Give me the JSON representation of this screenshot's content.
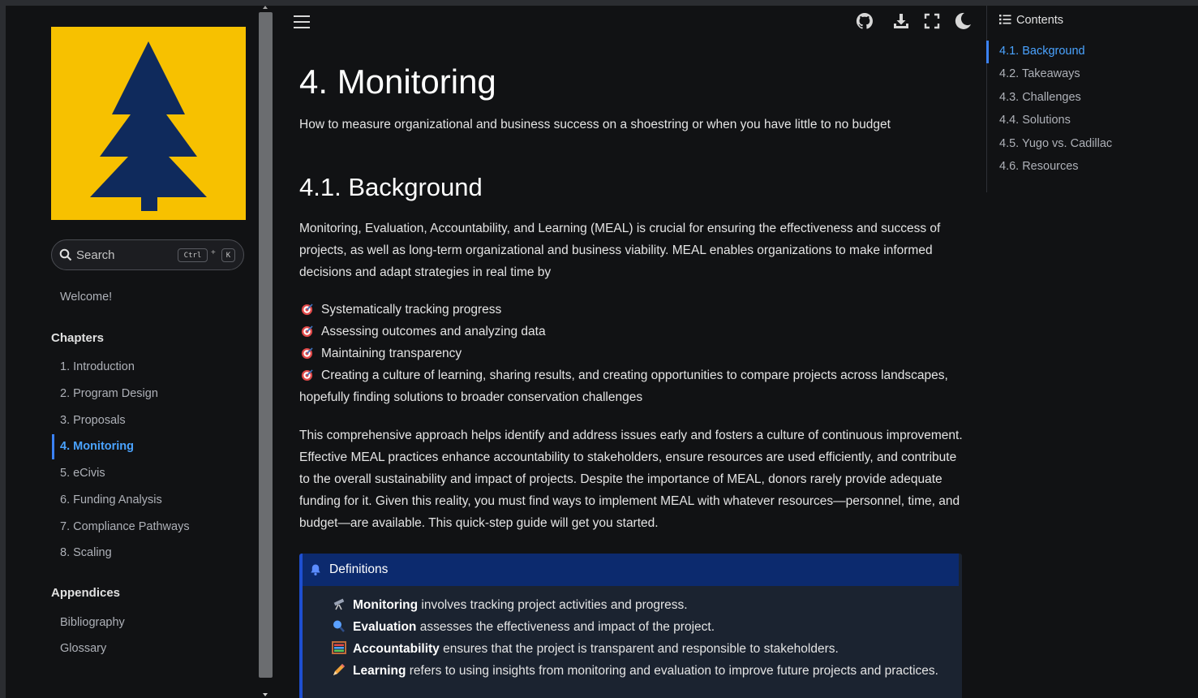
{
  "sidebar": {
    "search": {
      "label": "Search",
      "kbd_ctrl": "Ctrl",
      "kbd_plus": "+",
      "kbd_k": "K"
    },
    "welcome": "Welcome!",
    "chapters_heading": "Chapters",
    "chapters": [
      "1. Introduction",
      "2. Program Design",
      "3. Proposals",
      "4. Monitoring",
      "5. eCivis",
      "6. Funding Analysis",
      "7. Compliance Pathways",
      "8. Scaling"
    ],
    "appendices_heading": "Appendices",
    "appendices": [
      "Bibliography",
      "Glossary"
    ]
  },
  "toolbar": {
    "icons": [
      "menu-icon",
      "github-icon",
      "download-icon",
      "fullscreen-icon",
      "moon-icon"
    ]
  },
  "main": {
    "title": "4. Monitoring",
    "subtitle": "How to measure organizational and business success on a shoestring or when you have little to no budget",
    "section_title": "4.1. Background",
    "intro": "Monitoring, Evaluation, Accountability, and Learning (MEAL) is crucial for ensuring the effectiveness and success of projects, as well as long-term organizational and business viability. MEAL enables organizations to make informed decisions and adapt strategies in real time by",
    "bullets": [
      "Systematically tracking progress",
      "Assessing outcomes and analyzing data",
      "Maintaining transparency",
      "Creating a culture of learning, sharing results, and creating opportunities to compare projects across landscapes, hopefully finding solutions to broader conservation challenges"
    ],
    "paragraph2": "This comprehensive approach helps identify and address issues early and fosters a culture of continuous improvement. Effective MEAL practices enhance accountability to stakeholders, ensure resources are used efficiently, and contribute to the overall sustainability and impact of projects. Despite the importance of MEAL, donors rarely provide adequate funding for it. Given this reality, you must find ways to implement MEAL with whatever resources—personnel, time, and budget—are available. This quick-step guide will get you started.",
    "definitions": {
      "title": "Definitions",
      "items": [
        {
          "term": "Monitoring",
          "text": "involves tracking project activities and progress.",
          "icon": "telescope-icon"
        },
        {
          "term": "Evaluation",
          "text": "assesses the effectiveness and impact of the project.",
          "icon": "magnifier-icon"
        },
        {
          "term": "Accountability",
          "text": "ensures that the project is transparent and responsible to stakeholders.",
          "icon": "abacus-icon"
        },
        {
          "term": "Learning",
          "text": "refers to using insights from monitoring and evaluation to improve future projects and practices.",
          "icon": "pencil-icon"
        }
      ]
    }
  },
  "toc": {
    "heading": "Contents",
    "items": [
      "4.1. Background",
      "4.2. Takeaways",
      "4.3. Challenges",
      "4.4. Solutions",
      "4.5. Yugo vs. Cadillac",
      "4.6. Resources"
    ],
    "active_index": 0
  },
  "colors": {
    "logo_bg": "#f7c100",
    "logo_tree": "#0f2a5c",
    "link_active": "#4aa3ff",
    "admonition_head": "#0c2a6e"
  }
}
